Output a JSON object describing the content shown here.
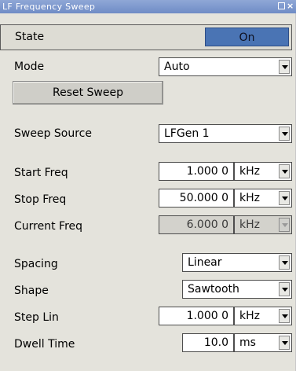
{
  "window": {
    "title": "LF Frequency Sweep"
  },
  "state": {
    "label": "State",
    "button": "On"
  },
  "mode": {
    "label": "Mode",
    "value": "Auto"
  },
  "reset_button": "Reset Sweep",
  "sweep_source": {
    "label": "Sweep Source",
    "value": "LFGen 1"
  },
  "start_freq": {
    "label": "Start Freq",
    "value": "1.000 0",
    "unit": "kHz"
  },
  "stop_freq": {
    "label": "Stop Freq",
    "value": "50.000 0",
    "unit": "kHz"
  },
  "current_freq": {
    "label": "Current Freq",
    "value": "6.000 0",
    "unit": "kHz"
  },
  "spacing": {
    "label": "Spacing",
    "value": "Linear"
  },
  "shape": {
    "label": "Shape",
    "value": "Sawtooth"
  },
  "step_lin": {
    "label": "Step Lin",
    "value": "1.000 0",
    "unit": "kHz"
  },
  "dwell_time": {
    "label": "Dwell Time",
    "value": "10.0",
    "unit": "ms"
  },
  "colors": {
    "title_bar": "#7b96cc",
    "on_button": "#4a74b4",
    "panel_bg": "#e4e3dc"
  }
}
